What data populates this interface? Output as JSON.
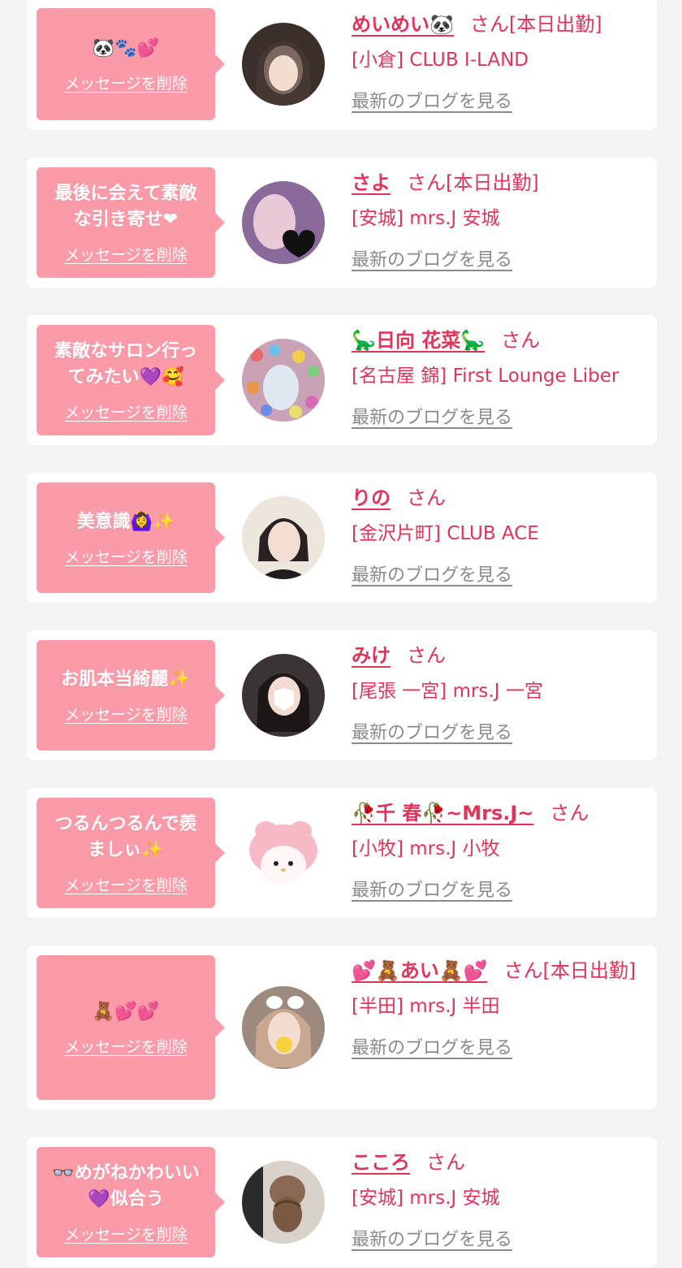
{
  "colors": {
    "accent": "#e0345b",
    "bubble": "#fb9aa8",
    "muted": "#8a8a8a",
    "background": "#f3f3f3"
  },
  "delete_label": "メッセージを削除",
  "blog_label": "最新のブログを見る",
  "entries": [
    {
      "message": "🐼🐾💕",
      "name": "めいめい🐼",
      "suffix": "さん[本日出勤]",
      "shop": "[小倉] CLUB I-LAND",
      "avatar_icon": "avatar-photo-icon"
    },
    {
      "message": "最後に会えて素敵な引き寄せ❤",
      "name": "さよ",
      "suffix": "さん[本日出勤]",
      "shop": "[安城] mrs.J 安城",
      "avatar_icon": "avatar-photo-icon"
    },
    {
      "message": "素敵なサロン行ってみたい💜🥰",
      "name": "🦕日向 花菜🦕",
      "suffix": "さん",
      "shop": "[名古屋 錦] First Lounge Liber",
      "avatar_icon": "avatar-photo-icon"
    },
    {
      "message": "美意識🙆‍♀️✨",
      "name": "りの",
      "suffix": "さん",
      "shop": "[金沢片町] CLUB ACE",
      "avatar_icon": "avatar-photo-icon"
    },
    {
      "message": "お肌本当綺麗✨",
      "name": "みけ",
      "suffix": "さん",
      "shop": "[尾張 一宮] mrs.J 一宮",
      "avatar_icon": "avatar-photo-icon"
    },
    {
      "message": "つるんつるんで羨ましぃ✨",
      "name": "🥀千 春🥀~Mrs.J~",
      "suffix": "さん",
      "shop": "[小牧] mrs.J 小牧",
      "avatar_icon": "avatar-character-icon"
    },
    {
      "message": "🧸💕💕",
      "name": "💕🧸あい🧸💕",
      "suffix": "さん[本日出勤]",
      "shop": "[半田] mrs.J 半田",
      "avatar_icon": "avatar-photo-icon"
    },
    {
      "message": "👓めがねかわいい💜似合う",
      "name": "こころ",
      "suffix": "さん",
      "shop": "[安城] mrs.J 安城",
      "avatar_icon": "avatar-photo-icon"
    }
  ]
}
